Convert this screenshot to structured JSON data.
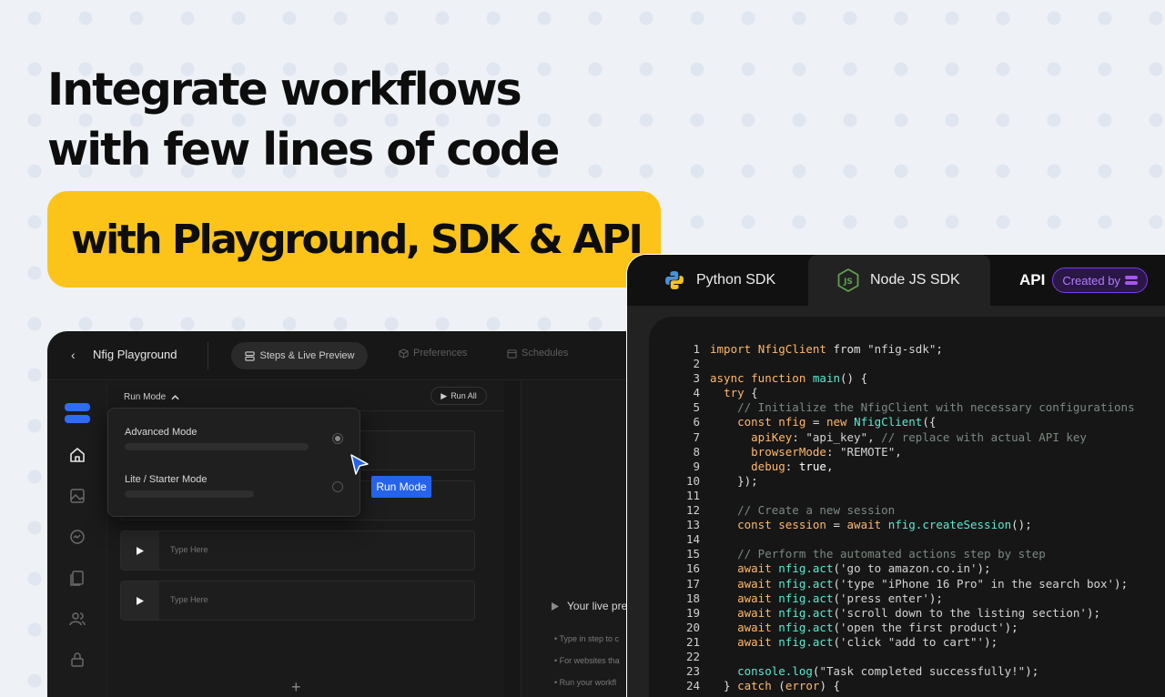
{
  "headline": {
    "line1": "Integrate workflows",
    "line2": "with few lines of code",
    "banner": "with Playground, SDK & API"
  },
  "playground": {
    "back_icon": "chevron-left-icon",
    "title": "Nfig Playground",
    "tabs": [
      {
        "label": "Steps & Live Preview",
        "icon": "layout-icon",
        "active": true
      },
      {
        "label": "Preferences",
        "icon": "cube-icon",
        "active": false
      },
      {
        "label": "Schedules",
        "icon": "calendar-icon",
        "active": false
      }
    ],
    "sidebar_icons": [
      "home-icon",
      "image-icon",
      "activity-icon",
      "documents-icon",
      "users-icon",
      "lock-icon"
    ],
    "run_mode_label": "Run Mode",
    "run_all_label": "Run All",
    "dropdown": {
      "options": [
        {
          "label": "Advanced Mode",
          "selected": true
        },
        {
          "label": "Lite / Starter Mode",
          "selected": false
        }
      ]
    },
    "tooltip": "Run Mode",
    "step_placeholder": "Type Here",
    "add_label": "+",
    "preview": {
      "title": "Your live pre",
      "bullets": [
        "Type in step to c",
        "For websites tha",
        "Run your workfl"
      ]
    }
  },
  "sdk": {
    "tabs": [
      {
        "label": "Python SDK",
        "icon": "python-icon",
        "active": false
      },
      {
        "label": "Node JS SDK",
        "icon": "nodejs-icon",
        "active": true
      }
    ],
    "api_label": "API",
    "created_by": "Created by",
    "code_lines": [
      {
        "n": "1",
        "parts": [
          [
            "kw",
            "import "
          ],
          [
            "cls",
            "NfigClient"
          ],
          [
            "df",
            " from "
          ],
          [
            "str",
            "\"nfig-sdk\""
          ],
          [
            "df",
            ";"
          ]
        ]
      },
      {
        "n": "2",
        "parts": []
      },
      {
        "n": "3",
        "parts": [
          [
            "kw",
            "async function "
          ],
          [
            "fn",
            "main"
          ],
          [
            "df",
            "() {"
          ]
        ]
      },
      {
        "n": "4",
        "parts": [
          [
            "df",
            "  "
          ],
          [
            "kw",
            "try"
          ],
          [
            "df",
            " {"
          ]
        ]
      },
      {
        "n": "5",
        "parts": [
          [
            "cm",
            "    // Initialize the NfigClient with necessary configurations"
          ]
        ]
      },
      {
        "n": "6",
        "parts": [
          [
            "df",
            "    "
          ],
          [
            "kw",
            "const "
          ],
          [
            "cls",
            "nfig"
          ],
          [
            "df",
            " = "
          ],
          [
            "kw",
            "new "
          ],
          [
            "fn",
            "NfigClient"
          ],
          [
            "df",
            "({"
          ]
        ]
      },
      {
        "n": "7",
        "parts": [
          [
            "df",
            "      "
          ],
          [
            "cls",
            "apiKey"
          ],
          [
            "df",
            ": "
          ],
          [
            "str",
            "\"api_key\""
          ],
          [
            "df",
            ", "
          ],
          [
            "cm",
            "// replace with actual API key"
          ]
        ]
      },
      {
        "n": "8",
        "parts": [
          [
            "df",
            "      "
          ],
          [
            "cls",
            "browserMode"
          ],
          [
            "df",
            ": "
          ],
          [
            "str",
            "\"REMOTE\""
          ],
          [
            "df",
            ","
          ]
        ]
      },
      {
        "n": "9",
        "parts": [
          [
            "df",
            "      "
          ],
          [
            "cls",
            "debug"
          ],
          [
            "df",
            ": "
          ],
          [
            "bool",
            "true"
          ],
          [
            "df",
            ","
          ]
        ]
      },
      {
        "n": "10",
        "parts": [
          [
            "df",
            "    });"
          ]
        ]
      },
      {
        "n": "11",
        "parts": []
      },
      {
        "n": "12",
        "parts": [
          [
            "cm",
            "    // Create a new session"
          ]
        ]
      },
      {
        "n": "13",
        "parts": [
          [
            "df",
            "    "
          ],
          [
            "kw",
            "const "
          ],
          [
            "cls",
            "session"
          ],
          [
            "df",
            " = "
          ],
          [
            "kw",
            "await "
          ],
          [
            "fn",
            "nfig.createSession"
          ],
          [
            "df",
            "();"
          ]
        ]
      },
      {
        "n": "14",
        "parts": []
      },
      {
        "n": "15",
        "parts": [
          [
            "cm",
            "    // Perform the automated actions step by step"
          ]
        ]
      },
      {
        "n": "16",
        "parts": [
          [
            "df",
            "    "
          ],
          [
            "kw",
            "await "
          ],
          [
            "fn",
            "nfig.act"
          ],
          [
            "df",
            "("
          ],
          [
            "str",
            "'go to amazon.co.in'"
          ],
          [
            "df",
            ");"
          ]
        ]
      },
      {
        "n": "17",
        "parts": [
          [
            "df",
            "    "
          ],
          [
            "kw",
            "await "
          ],
          [
            "fn",
            "nfig.act"
          ],
          [
            "df",
            "("
          ],
          [
            "str",
            "'type \"iPhone 16 Pro\" in the search box'"
          ],
          [
            "df",
            ");"
          ]
        ]
      },
      {
        "n": "18",
        "parts": [
          [
            "df",
            "    "
          ],
          [
            "kw",
            "await "
          ],
          [
            "fn",
            "nfig.act"
          ],
          [
            "df",
            "("
          ],
          [
            "str",
            "'press enter'"
          ],
          [
            "df",
            ");"
          ]
        ]
      },
      {
        "n": "19",
        "parts": [
          [
            "df",
            "    "
          ],
          [
            "kw",
            "await "
          ],
          [
            "fn",
            "nfig.act"
          ],
          [
            "df",
            "("
          ],
          [
            "str",
            "'scroll down to the listing section'"
          ],
          [
            "df",
            ");"
          ]
        ]
      },
      {
        "n": "20",
        "parts": [
          [
            "df",
            "    "
          ],
          [
            "kw",
            "await "
          ],
          [
            "fn",
            "nfig.act"
          ],
          [
            "df",
            "("
          ],
          [
            "str",
            "'open the first product'"
          ],
          [
            "df",
            ");"
          ]
        ]
      },
      {
        "n": "21",
        "parts": [
          [
            "df",
            "    "
          ],
          [
            "kw",
            "await "
          ],
          [
            "fn",
            "nfig.act"
          ],
          [
            "df",
            "("
          ],
          [
            "str",
            "'click \"add to cart\"'"
          ],
          [
            "df",
            ");"
          ]
        ]
      },
      {
        "n": "22",
        "parts": []
      },
      {
        "n": "23",
        "parts": [
          [
            "df",
            "    "
          ],
          [
            "fn",
            "console.log"
          ],
          [
            "df",
            "("
          ],
          [
            "str",
            "\"Task completed successfully!\""
          ],
          [
            "df",
            ");"
          ]
        ]
      },
      {
        "n": "24",
        "parts": [
          [
            "df",
            "  } "
          ],
          [
            "kw",
            "catch"
          ],
          [
            "df",
            " ("
          ],
          [
            "cls",
            "error"
          ],
          [
            "df",
            ") {"
          ]
        ]
      }
    ]
  },
  "colors": {
    "banner": "#fcc419",
    "accent_blue": "#2563eb",
    "badge_purple": "#a855f7"
  }
}
